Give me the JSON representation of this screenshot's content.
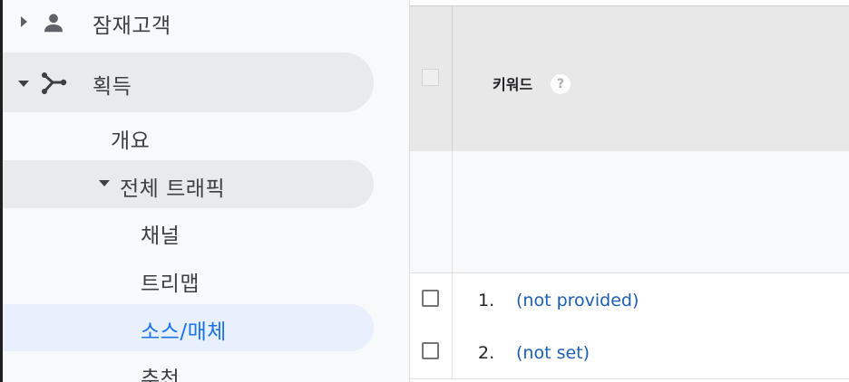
{
  "sidebar": {
    "audience": {
      "label": "잠재고객",
      "icon": "person-icon"
    },
    "acquisition": {
      "label": "획득",
      "icon": "acquisition-icon"
    },
    "overview": {
      "label": "개요"
    },
    "all_traffic": {
      "label": "전체 트래픽"
    },
    "channels": {
      "label": "채널"
    },
    "treemap": {
      "label": "트리맵"
    },
    "source_medium": {
      "label": "소스/매체"
    },
    "referrals": {
      "label": "추천"
    }
  },
  "table": {
    "column_header": "키워드",
    "help_symbol": "?",
    "rows": [
      {
        "index": "1.",
        "keyword": "(not provided)"
      },
      {
        "index": "2.",
        "keyword": "(not set)"
      }
    ]
  },
  "colors": {
    "sidebar_bg": "#f8f9fa",
    "selected_pill": "#e8f0fe",
    "selected_text": "#1a73e8",
    "link": "#1a5fb4",
    "header_bg": "#e8e8e8"
  }
}
